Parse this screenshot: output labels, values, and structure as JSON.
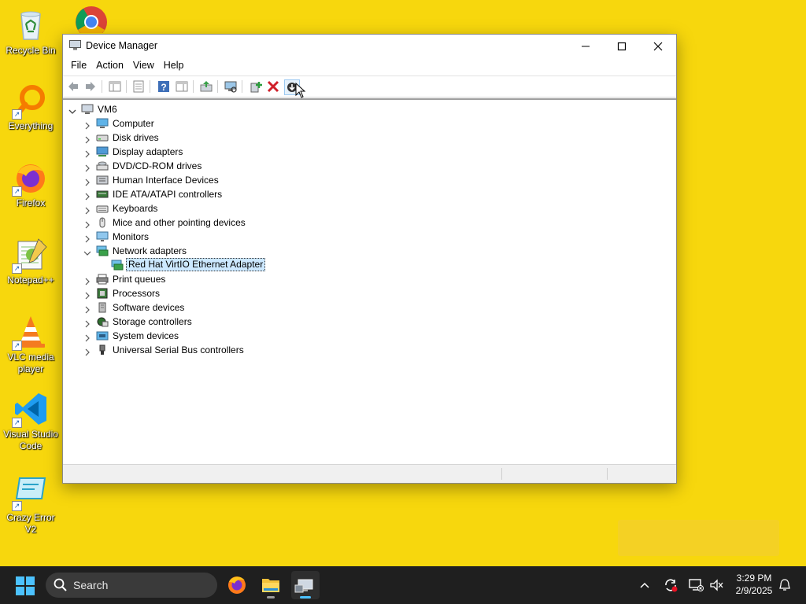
{
  "desktop": {
    "icons": [
      {
        "label": "Recycle Bin"
      },
      {
        "label": "Everything"
      },
      {
        "label": "Firefox"
      },
      {
        "label": "Notepad++"
      },
      {
        "label": "VLC media player"
      },
      {
        "label": "Visual Studio Code"
      },
      {
        "label": "Crazy Error V2"
      }
    ]
  },
  "window": {
    "title": "Device Manager",
    "menu": [
      "File",
      "Action",
      "View",
      "Help"
    ],
    "toolbar_icons": [
      "back-icon",
      "forward-icon",
      "show-hide-console-tree-icon",
      "properties-icon",
      "help-icon",
      "action-pane-icon",
      "update-driver-icon",
      "scan-hardware-icon",
      "add-legacy-hardware-icon",
      "uninstall-device-icon",
      "disable-device-icon"
    ],
    "tree": {
      "root": "VM6",
      "categories": [
        {
          "label": "Computer",
          "icon": "computer-icon"
        },
        {
          "label": "Disk drives",
          "icon": "disk-drive-icon"
        },
        {
          "label": "Display adapters",
          "icon": "display-adapter-icon"
        },
        {
          "label": "DVD/CD-ROM drives",
          "icon": "dvd-drive-icon"
        },
        {
          "label": "Human Interface Devices",
          "icon": "hid-icon"
        },
        {
          "label": "IDE ATA/ATAPI controllers",
          "icon": "ide-controller-icon"
        },
        {
          "label": "Keyboards",
          "icon": "keyboard-icon"
        },
        {
          "label": "Mice and other pointing devices",
          "icon": "mouse-icon"
        },
        {
          "label": "Monitors",
          "icon": "monitor-icon"
        },
        {
          "label": "Network adapters",
          "icon": "network-adapter-icon",
          "expanded": true,
          "children": [
            {
              "label": "Red Hat VirtIO Ethernet Adapter",
              "selected": true
            }
          ]
        },
        {
          "label": "Print queues",
          "icon": "printer-icon"
        },
        {
          "label": "Processors",
          "icon": "processor-icon"
        },
        {
          "label": "Software devices",
          "icon": "software-device-icon"
        },
        {
          "label": "Storage controllers",
          "icon": "storage-controller-icon"
        },
        {
          "label": "System devices",
          "icon": "system-device-icon"
        },
        {
          "label": "Universal Serial Bus controllers",
          "icon": "usb-icon"
        }
      ]
    }
  },
  "taskbar": {
    "search_placeholder": "Search",
    "apps": [
      "firefox-icon",
      "file-explorer-icon",
      "device-manager-icon"
    ],
    "time": "3:29 PM",
    "date": "2/9/2025"
  },
  "colors": {
    "desktop": "#f7d70d",
    "selection": "#cce8ff",
    "taskbar": "#1f1f1f",
    "accent": "#4cc2ff"
  }
}
